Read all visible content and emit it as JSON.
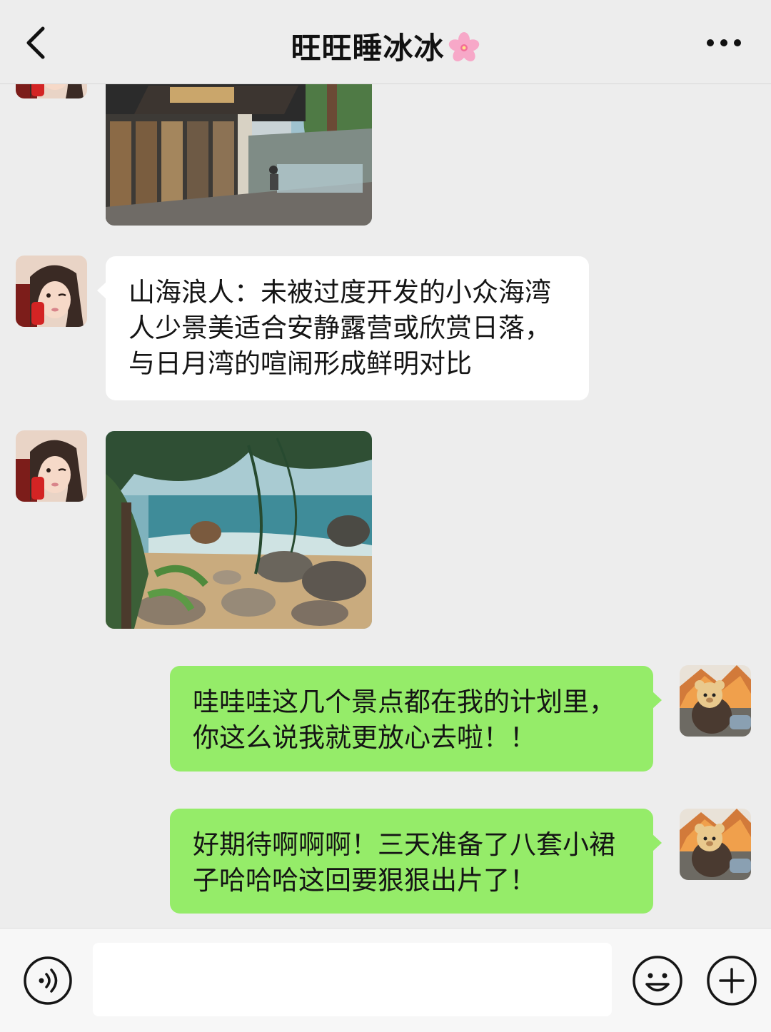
{
  "header": {
    "title": "旺旺睡冰冰",
    "title_emoji": "cherry-blossom",
    "back_icon": "chevron-left-icon",
    "more_icon": "more-dots-icon"
  },
  "messages": [
    {
      "side": "left",
      "type": "image",
      "sender": "contact",
      "content": "cafe-terrace-photo"
    },
    {
      "side": "left",
      "type": "text",
      "sender": "contact",
      "lines": [
        "山海浪人：未被过度开发的小众海湾",
        "人少景美适合安静露营或欣赏日落，",
        "与日月湾的喧闹形成鲜明对比"
      ]
    },
    {
      "side": "left",
      "type": "image",
      "sender": "contact",
      "content": "rocky-beach-photo"
    },
    {
      "side": "right",
      "type": "text",
      "sender": "me",
      "lines": [
        "哇哇哇这几个景点都在我的计划里，",
        "你这么说我就更放心去啦！！"
      ]
    },
    {
      "side": "right",
      "type": "text",
      "sender": "me",
      "lines": [
        "好期待啊啊啊！三天准备了八套小裙",
        "子哈哈哈这回要狠狠出片了！"
      ]
    }
  ],
  "input_bar": {
    "voice_icon": "voice-icon",
    "input_value": "",
    "emoji_icon": "emoji-icon",
    "plus_icon": "plus-icon"
  },
  "colors": {
    "background": "#ededed",
    "left_bubble": "#ffffff",
    "right_bubble": "#95ec69",
    "text": "#151515"
  }
}
